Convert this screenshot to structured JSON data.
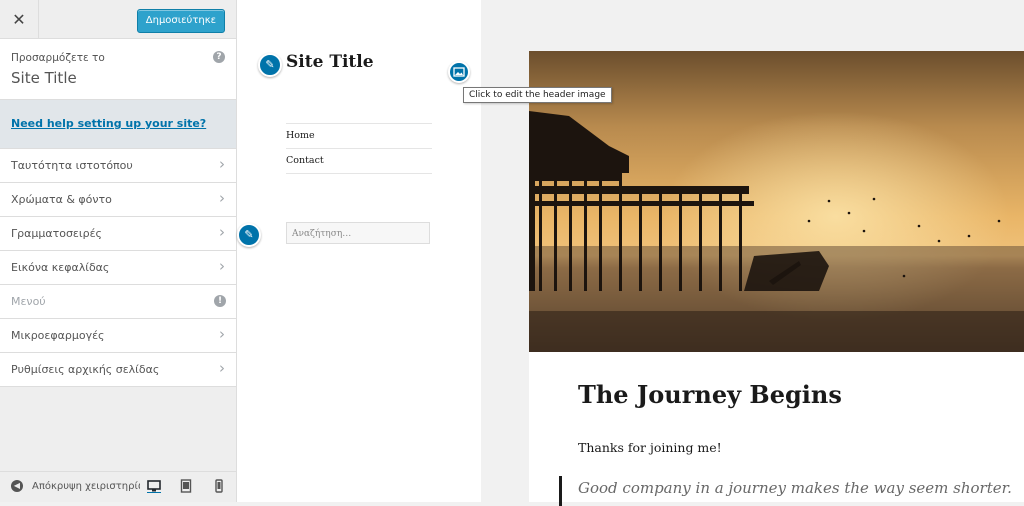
{
  "sidebar": {
    "close_label": "✕",
    "publish_label": "Δημοσιεύτηκε",
    "info_label": "Προσαρμόζετε το",
    "site_title": "Site Title",
    "help_icon": "?",
    "help_link": "Need help setting up your site?",
    "items": [
      {
        "label": "Ταυτότητα ιστοτόπου"
      },
      {
        "label": "Χρώματα & φόντο"
      },
      {
        "label": "Γραμματοσειρές"
      },
      {
        "label": "Εικόνα κεφαλίδας"
      },
      {
        "label": "Μενού"
      },
      {
        "label": "Μικροεφαρμογές"
      },
      {
        "label": "Ρυθμίσεις αρχικής σελίδας"
      }
    ],
    "warn_icon": "!",
    "footer": {
      "collapse_label": "Απόκρυψη χειριστηρίων"
    }
  },
  "preview": {
    "site_title": "Site Title",
    "tooltip": "Click to edit the header image",
    "menu": [
      "Home",
      "Contact"
    ],
    "search_placeholder": "Αναζήτηση…",
    "post": {
      "title": "The Journey Begins",
      "text": "Thanks for joining me!",
      "quote": "Good company in a journey makes the way seem shorter."
    }
  },
  "colors": {
    "accent": "#0073aa",
    "publish": "#2ea2cc"
  },
  "icons": [
    "close-icon",
    "help-icon",
    "chevron-right-icon",
    "warning-icon",
    "collapse-icon",
    "desktop-icon",
    "tablet-icon",
    "mobile-icon",
    "pencil-icon",
    "image-icon"
  ]
}
